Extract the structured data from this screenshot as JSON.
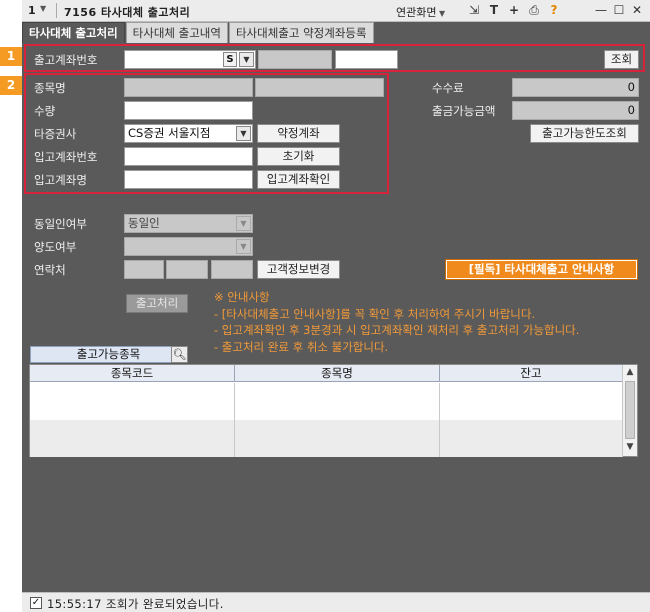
{
  "titlebar": {
    "number": "1",
    "screen_id": "7156",
    "title": "타사대체 출고처리",
    "related_label": "연관화면",
    "icons": [
      "link-icon",
      "text-icon",
      "plus-icon",
      "print-icon",
      "help-icon"
    ],
    "help_glyph": "?"
  },
  "tabs": [
    {
      "label": "타사대체 출고처리",
      "active": true
    },
    {
      "label": "타사대체 출고내역",
      "active": false
    },
    {
      "label": "타사대체출고 약정계좌등록",
      "active": false
    }
  ],
  "side_numbers": [
    "1",
    "2"
  ],
  "account_row": {
    "label": "출고계좌번호",
    "account_value": "",
    "suffix_value": "S",
    "query_button": "조회"
  },
  "transfer_form": {
    "item_name_label": "종목명",
    "item_name_value": "",
    "quantity_label": "수량",
    "quantity_value": "",
    "other_broker_label": "타증권사",
    "other_broker_value": "CS증권 서울지점",
    "contract_account_button": "약정계좌",
    "deposit_account_label": "입고계좌번호",
    "deposit_account_value": "",
    "reset_button": "초기화",
    "deposit_name_label": "입고계좌명",
    "deposit_name_value": "",
    "confirm_deposit_button": "입고계좌확인"
  },
  "fee": {
    "fee_label": "수수료",
    "fee_value": "0",
    "available_amount_label": "출금가능금액",
    "available_amount_value": "0",
    "limit_query_button": "출고가능한도조회"
  },
  "details": {
    "same_person_label": "동일인여부",
    "same_person_value": "동일인",
    "transfer_type_label": "양도여부",
    "transfer_type_value": "",
    "contact_label": "연락처",
    "contact_parts": [
      "",
      "",
      ""
    ],
    "customer_info_button": "고객정보변경",
    "guide_button": "[필독] 타사대체출고 안내사항"
  },
  "process_button": "출고처리",
  "notice_lines": [
    "※ 안내사항",
    "- [타사대체출고 안내사항]를 꼭 확인 후 처리하여 주시기 바랍니다.",
    "- 입고계좌확인 후 3분경과 시 입고계좌확인 재처리 후 출고처리 가능합니다.",
    "- 출고처리 완료 후 취소 불가합니다."
  ],
  "stock_search": {
    "label": "출고가능종목"
  },
  "grid": {
    "columns": [
      "종목코드",
      "종목명",
      "잔고"
    ],
    "rows": [
      [
        "",
        "",
        ""
      ],
      [
        "",
        "",
        ""
      ]
    ]
  },
  "status": {
    "time": "15:55:17",
    "message": "조회가 완료되었습니다.",
    "text": "15:55:17 조회가 완료되었습니다."
  }
}
